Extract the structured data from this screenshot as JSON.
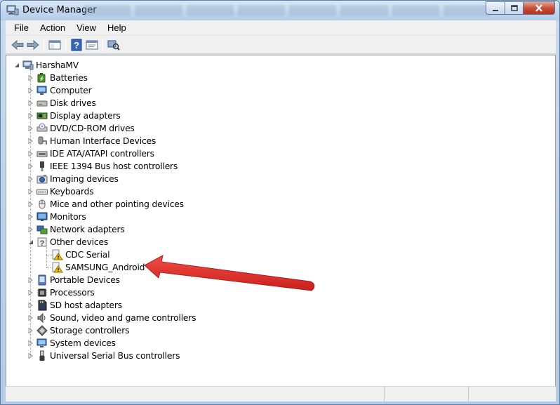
{
  "window": {
    "title": "Device Manager",
    "icon": "device-manager-icon",
    "controls": [
      "minimize-icon",
      "maximize-icon",
      "close-icon"
    ]
  },
  "menu": {
    "items": [
      "File",
      "Action",
      "View",
      "Help"
    ]
  },
  "toolbar": {
    "buttons": [
      "back-arrow-icon",
      "forward-arrow-icon",
      "show-hide-console-tree-icon",
      "help-icon",
      "properties-icon",
      "scan-hardware-changes-icon"
    ]
  },
  "tree": {
    "root": "HarshaMV",
    "items": [
      {
        "label": "Batteries",
        "icon": "battery-icon",
        "expanded": false
      },
      {
        "label": "Computer",
        "icon": "computer-icon",
        "expanded": false
      },
      {
        "label": "Disk drives",
        "icon": "disk-drive-icon",
        "expanded": false
      },
      {
        "label": "Display adapters",
        "icon": "display-adapter-icon",
        "expanded": false
      },
      {
        "label": "DVD/CD-ROM drives",
        "icon": "dvd-drive-icon",
        "expanded": false
      },
      {
        "label": "Human Interface Devices",
        "icon": "hid-icon",
        "expanded": false
      },
      {
        "label": "IDE ATA/ATAPI controllers",
        "icon": "ide-controller-icon",
        "expanded": false
      },
      {
        "label": "IEEE 1394 Bus host controllers",
        "icon": "ieee1394-icon",
        "expanded": false
      },
      {
        "label": "Imaging devices",
        "icon": "camera-icon",
        "expanded": false
      },
      {
        "label": "Keyboards",
        "icon": "keyboard-icon",
        "expanded": false
      },
      {
        "label": "Mice and other pointing devices",
        "icon": "mouse-icon",
        "expanded": false
      },
      {
        "label": "Monitors",
        "icon": "monitor-icon",
        "expanded": false
      },
      {
        "label": "Network adapters",
        "icon": "network-adapter-icon",
        "expanded": false
      },
      {
        "label": "Other devices",
        "icon": "unknown-device-icon",
        "expanded": true,
        "children": [
          {
            "label": "CDC Serial",
            "icon": "warning-device-icon"
          },
          {
            "label": "SAMSUNG_Android",
            "icon": "warning-device-icon"
          }
        ]
      },
      {
        "label": "Portable Devices",
        "icon": "portable-device-icon",
        "expanded": false
      },
      {
        "label": "Processors",
        "icon": "processor-icon",
        "expanded": false
      },
      {
        "label": "SD host adapters",
        "icon": "sd-card-icon",
        "expanded": false
      },
      {
        "label": "Sound, video and game controllers",
        "icon": "speaker-icon",
        "expanded": false
      },
      {
        "label": "Storage controllers",
        "icon": "storage-controller-icon",
        "expanded": false
      },
      {
        "label": "System devices",
        "icon": "system-device-icon",
        "expanded": false
      },
      {
        "label": "Universal Serial Bus controllers",
        "icon": "usb-icon",
        "expanded": false
      }
    ]
  },
  "annotation": {
    "type": "red-arrow-icon",
    "points_to": "SAMSUNG_Android",
    "color": "#e3201b"
  },
  "colors": {
    "title_bar": "#c4d8ee",
    "warning": "#f2c200"
  }
}
